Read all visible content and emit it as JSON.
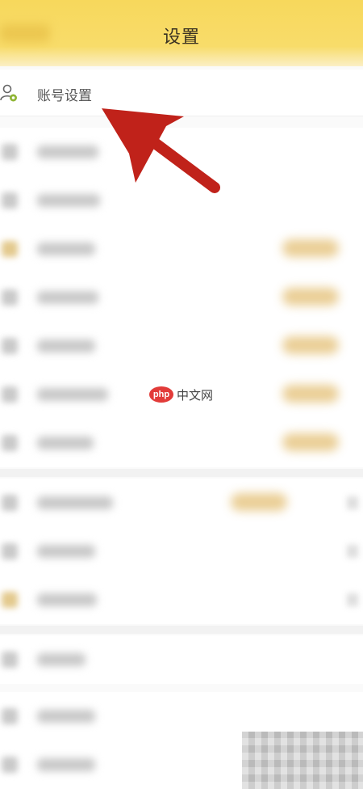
{
  "header": {
    "title": "设置"
  },
  "account_row": {
    "label": "账号设置"
  },
  "watermark": {
    "badge": "php",
    "text": "中文网"
  },
  "colors": {
    "header_yellow": "#f7d85c",
    "arrow_red": "#c0221a",
    "badge_red": "#e23b39"
  },
  "icons": [
    "account-settings-icon",
    "back-icon"
  ]
}
